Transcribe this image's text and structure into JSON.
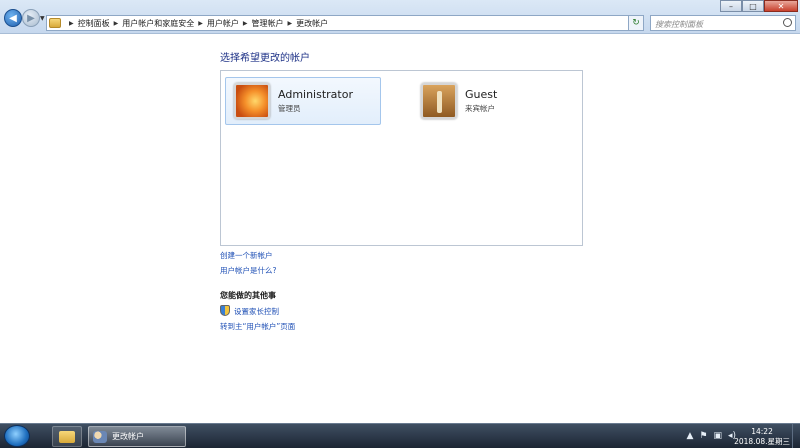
{
  "breadcrumb": [
    "控制面板",
    "用户帐户和家庭安全",
    "用户帐户",
    "管理帐户",
    "更改帐户"
  ],
  "search": {
    "placeholder": "搜索控制面板"
  },
  "main": {
    "heading": "选择希望更改的帐户",
    "accounts": [
      {
        "name": "Administrator",
        "role": "管理员"
      },
      {
        "name": "Guest",
        "role": "来宾帐户"
      }
    ],
    "links": {
      "create_account": "创建一个新帐户",
      "what_is_account": "用户帐户是什么?"
    },
    "other_section": {
      "title": "您能做的其他事",
      "parental_controls": "设置家长控制",
      "go_to_main": "转到主“用户帐户”页面"
    }
  },
  "taskbar": {
    "active_window": "更改帐户",
    "time": "14:22",
    "date": "2018.08.星期三"
  },
  "icons": {
    "back": "arrow-left-icon",
    "forward": "arrow-right-icon",
    "refresh": "refresh-icon",
    "search": "search-icon",
    "shield": "shield-icon",
    "start": "windows-start-icon"
  }
}
